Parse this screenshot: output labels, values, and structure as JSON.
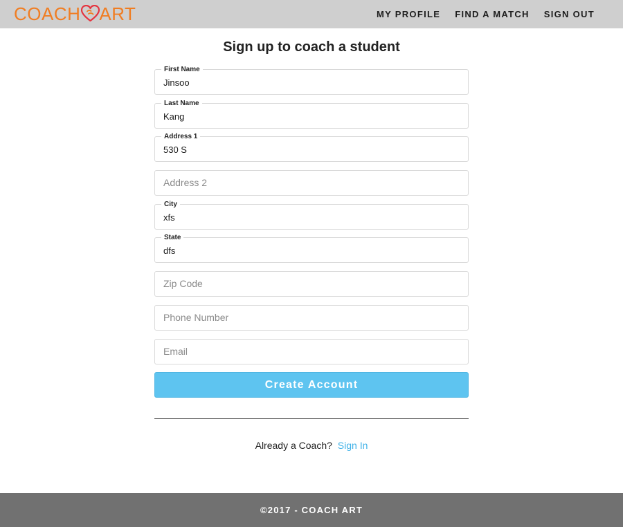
{
  "brand": {
    "name_left": "COACH",
    "name_right": "ART",
    "logo_color": "#f07d22",
    "heart_color": "#e5343f",
    "icon": "heart-icon"
  },
  "nav": {
    "items": [
      {
        "label": "MY PROFILE"
      },
      {
        "label": "FIND A MATCH"
      },
      {
        "label": "SIGN OUT"
      }
    ]
  },
  "page": {
    "title": "Sign up to coach a student"
  },
  "form": {
    "fields": [
      {
        "label": "First Name",
        "value": "Jinsoo",
        "placeholder": ""
      },
      {
        "label": "Last Name",
        "value": "Kang",
        "placeholder": ""
      },
      {
        "label": "Address 1",
        "value": "530 S",
        "placeholder": ""
      },
      {
        "label": "",
        "value": "",
        "placeholder": "Address 2"
      },
      {
        "label": "City",
        "value": "xfs",
        "placeholder": ""
      },
      {
        "label": "State",
        "value": "dfs",
        "placeholder": ""
      },
      {
        "label": "",
        "value": "",
        "placeholder": "Zip Code"
      },
      {
        "label": "",
        "value": "",
        "placeholder": "Phone Number"
      },
      {
        "label": "",
        "value": "",
        "placeholder": "Email"
      }
    ],
    "submit_label": "Create Account",
    "submit_color": "#5ec4f0"
  },
  "signin": {
    "prompt": "Already a Coach?",
    "link_label": "Sign In",
    "link_color": "#3fb2e8"
  },
  "footer": {
    "text": "©2017 - COACH ART"
  }
}
